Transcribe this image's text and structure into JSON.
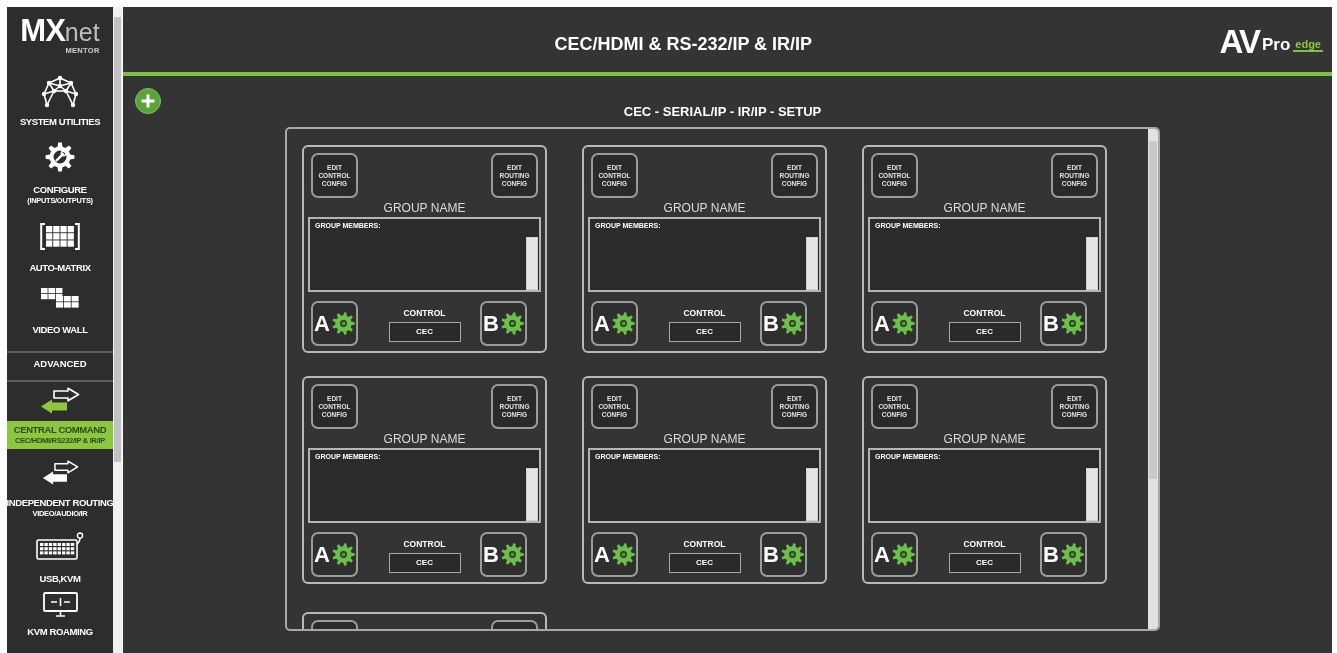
{
  "sidebar": {
    "logo": {
      "text": "MX",
      "accent": "net",
      "tagline": "MENTOR"
    },
    "items": [
      {
        "kind": "nav",
        "label": "SYSTEM UTILITIES",
        "selected": false
      },
      {
        "kind": "nav",
        "label": "CONFIGURE",
        "sublabel": "(INPUTS/OUTPUTS)",
        "selected": false
      },
      {
        "kind": "nav",
        "label": "AUTO-MATRIX",
        "selected": false
      },
      {
        "kind": "nav",
        "label": "VIDEO WALL",
        "selected": false
      },
      {
        "kind": "section",
        "label": "ADVANCED"
      },
      {
        "kind": "nav",
        "label": "CENTRAL COMMAND",
        "sublabel": "CEC/HDMI/RS232/IP & IR/IP",
        "selected": true
      },
      {
        "kind": "nav",
        "label": "INDEPENDENT ROUTING",
        "sublabel": "VIDEO/AUDIO/IR",
        "selected": false
      },
      {
        "kind": "nav",
        "label": "USB,KVM",
        "selected": false
      },
      {
        "kind": "nav",
        "label": "KVM ROAMING",
        "selected": false
      }
    ]
  },
  "header": {
    "title": "CEC/HDMI & RS-232/IP & IR/IP",
    "logo": {
      "text": "AV",
      "accent": "Pro",
      "tag": "edge"
    }
  },
  "setup": {
    "title": "CEC - SERIAL/IP - IR/IP - SETUP",
    "groups": [
      {
        "kind": "full",
        "edit_control": "EDIT CONTROL CONFIG",
        "edit_routing": "EDIT ROUTING CONFIG",
        "name": "GROUP NAME",
        "members_label": "GROUP MEMBERS:",
        "button_a": "A",
        "control_label": "CONTROL",
        "control_value": "CEC",
        "button_b": "B"
      },
      {
        "kind": "full",
        "edit_control": "EDIT CONTROL CONFIG",
        "edit_routing": "EDIT ROUTING CONFIG",
        "name": "GROUP NAME",
        "members_label": "GROUP MEMBERS:",
        "button_a": "A",
        "control_label": "CONTROL",
        "control_value": "CEC",
        "button_b": "B"
      },
      {
        "kind": "full",
        "edit_control": "EDIT CONTROL CONFIG",
        "edit_routing": "EDIT ROUTING CONFIG",
        "name": "GROUP NAME",
        "members_label": "GROUP MEMBERS:",
        "button_a": "A",
        "control_label": "CONTROL",
        "control_value": "CEC",
        "button_b": "B"
      },
      {
        "kind": "full",
        "edit_control": "EDIT CONTROL CONFIG",
        "edit_routing": "EDIT ROUTING CONFIG",
        "name": "GROUP NAME",
        "members_label": "GROUP MEMBERS:",
        "button_a": "A",
        "control_label": "CONTROL",
        "control_value": "CEC",
        "button_b": "B"
      },
      {
        "kind": "full",
        "edit_control": "EDIT CONTROL CONFIG",
        "edit_routing": "EDIT ROUTING CONFIG",
        "name": "GROUP NAME",
        "members_label": "GROUP MEMBERS:",
        "button_a": "A",
        "control_label": "CONTROL",
        "control_value": "CEC",
        "button_b": "B"
      },
      {
        "kind": "full",
        "edit_control": "EDIT CONTROL CONFIG",
        "edit_routing": "EDIT ROUTING CONFIG",
        "name": "GROUP NAME",
        "members_label": "GROUP MEMBERS:",
        "button_a": "A",
        "control_label": "CONTROL",
        "control_value": "CEC",
        "button_b": "B"
      },
      {
        "kind": "cut_off"
      }
    ]
  }
}
